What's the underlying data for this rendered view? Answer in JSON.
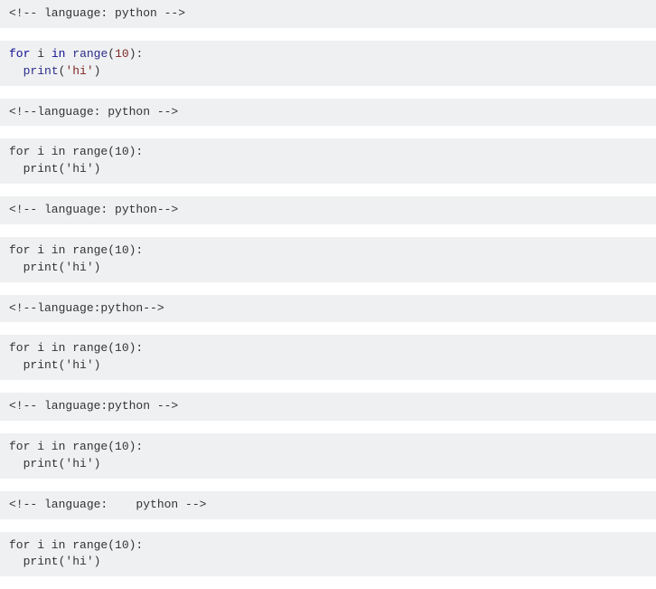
{
  "blocks": [
    {
      "type": "highlighted",
      "hint": "<!-- language: python -->",
      "tokens": [
        {
          "t": "for",
          "cls": "tok-kw"
        },
        {
          "t": " ",
          "cls": "tok-plain"
        },
        {
          "t": "i",
          "cls": "tok-plain"
        },
        {
          "t": " ",
          "cls": "tok-plain"
        },
        {
          "t": "in",
          "cls": "tok-kw"
        },
        {
          "t": " ",
          "cls": "tok-plain"
        },
        {
          "t": "range",
          "cls": "tok-fn"
        },
        {
          "t": "(",
          "cls": "tok-paren"
        },
        {
          "t": "10",
          "cls": "tok-num"
        },
        {
          "t": "):",
          "cls": "tok-paren"
        },
        {
          "t": "\n  ",
          "cls": "tok-plain"
        },
        {
          "t": "print",
          "cls": "tok-fn"
        },
        {
          "t": "(",
          "cls": "tok-paren"
        },
        {
          "t": "'hi'",
          "cls": "tok-str"
        },
        {
          "t": ")",
          "cls": "tok-paren"
        }
      ]
    },
    {
      "type": "plain",
      "hint": "<!--language: python -->",
      "code": "for i in range(10):\n  print('hi')"
    },
    {
      "type": "plain",
      "hint": "<!-- language: python-->",
      "code": "for i in range(10):\n  print('hi')"
    },
    {
      "type": "plain",
      "hint": "<!--language:python-->",
      "code": "for i in range(10):\n  print('hi')"
    },
    {
      "type": "plain",
      "hint": "<!-- language:python -->",
      "code": "for i in range(10):\n  print('hi')"
    },
    {
      "type": "plain",
      "hint": "<!-- language:    python -->",
      "code": "for i in range(10):\n  print('hi')"
    }
  ]
}
